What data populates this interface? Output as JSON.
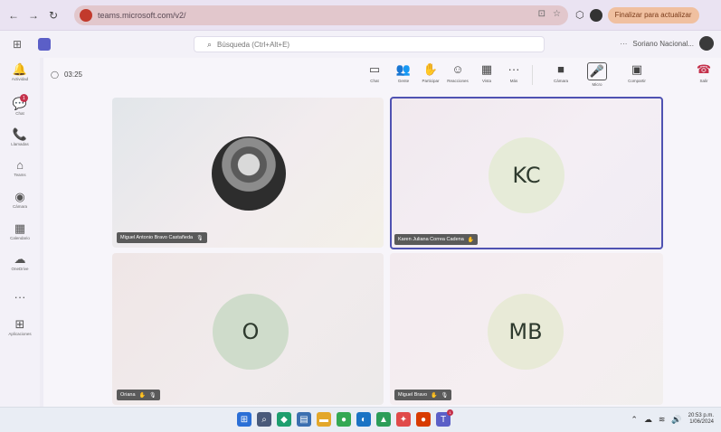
{
  "browser": {
    "back_glyph": "←",
    "forward_glyph": "→",
    "reload_glyph": "↻",
    "url": "teams.microsoft.com/v2/",
    "star_glyph": "☆",
    "profile_label": "Finalizar para actualizar"
  },
  "app": {
    "search_placeholder": "Búsqueda (Ctrl+Alt+E)",
    "account_label": "Soriano Nacional..."
  },
  "rail": [
    {
      "label": "Actividad",
      "icon": "bell-icon",
      "glyph": "🔔"
    },
    {
      "label": "Chat",
      "icon": "chat-icon",
      "glyph": "💬",
      "badge": "1"
    },
    {
      "label": "Llamadas",
      "icon": "phone-icon",
      "glyph": "📞"
    },
    {
      "label": "Teams",
      "icon": "teams-icon",
      "glyph": "⌂"
    },
    {
      "label": "Cámara",
      "icon": "camera-icon",
      "glyph": "◉"
    },
    {
      "label": "Calendario",
      "icon": "calendar-icon",
      "glyph": "▦"
    },
    {
      "label": "OneDrive",
      "icon": "cloud-icon",
      "glyph": "☁"
    },
    {
      "label": "",
      "icon": "more-icon",
      "glyph": "···"
    },
    {
      "label": "Aplicaciones",
      "icon": "apps-icon",
      "glyph": "⊞"
    }
  ],
  "meeting": {
    "timer": "03:25",
    "toolbar": [
      {
        "label": "Chat",
        "icon": "chat-icon",
        "glyph": "▭"
      },
      {
        "label": "Gente",
        "icon": "people-icon",
        "glyph": "👥"
      },
      {
        "label": "Participar",
        "icon": "raise-hand-icon",
        "glyph": "✋"
      },
      {
        "label": "Reacciones",
        "icon": "smile-icon",
        "glyph": "☺"
      },
      {
        "label": "Vista",
        "icon": "view-icon",
        "glyph": "▦"
      },
      {
        "label": "Más",
        "icon": "more-icon",
        "glyph": "···"
      },
      {
        "label": "Cámara",
        "icon": "camera-icon",
        "glyph": "■"
      },
      {
        "label": "Micro",
        "icon": "mic-icon",
        "glyph": "🎤"
      },
      {
        "label": "Compartir",
        "icon": "share-icon",
        "glyph": "▣"
      },
      {
        "label": "Salir",
        "icon": "leave-icon",
        "glyph": "☎"
      }
    ],
    "participants": [
      {
        "name": "Miguel Antonio Bravo Castañeda",
        "initials": "",
        "has_photo": true
      },
      {
        "name": "Karen Juliana Correa Cadena",
        "initials": "KC",
        "has_photo": false
      },
      {
        "name": "Oriana",
        "initials": "O",
        "has_photo": false
      },
      {
        "name": "Miguel Bravo",
        "initials": "MB",
        "has_photo": false
      }
    ]
  },
  "taskbar": {
    "apps": [
      {
        "icon": "windows-start-icon",
        "color": "#2b6fd6",
        "glyph": "⊞"
      },
      {
        "icon": "search-icon",
        "color": "#4a5a7a",
        "glyph": "⌕"
      },
      {
        "icon": "copilot-icon",
        "color": "#1e9e6e",
        "glyph": "◆"
      },
      {
        "icon": "task-view-icon",
        "color": "#3b6fb0",
        "glyph": "▤"
      },
      {
        "icon": "file-explorer-icon",
        "color": "#e3a72a",
        "glyph": "▬"
      },
      {
        "icon": "chrome-icon",
        "color": "#34a853",
        "glyph": "●"
      },
      {
        "icon": "edge-icon",
        "color": "#1a73c4",
        "glyph": "◐"
      },
      {
        "icon": "store-icon",
        "color": "#2c9d58",
        "glyph": "▲"
      },
      {
        "icon": "maps-icon",
        "color": "#e04a4a",
        "glyph": "✦"
      },
      {
        "icon": "office-icon",
        "color": "#d83b01",
        "glyph": "●"
      },
      {
        "icon": "teams-icon",
        "color": "#5b5fc7",
        "glyph": "T",
        "badge": "1"
      }
    ],
    "time": "20:53 p.m.",
    "date": "1/06/2024"
  }
}
